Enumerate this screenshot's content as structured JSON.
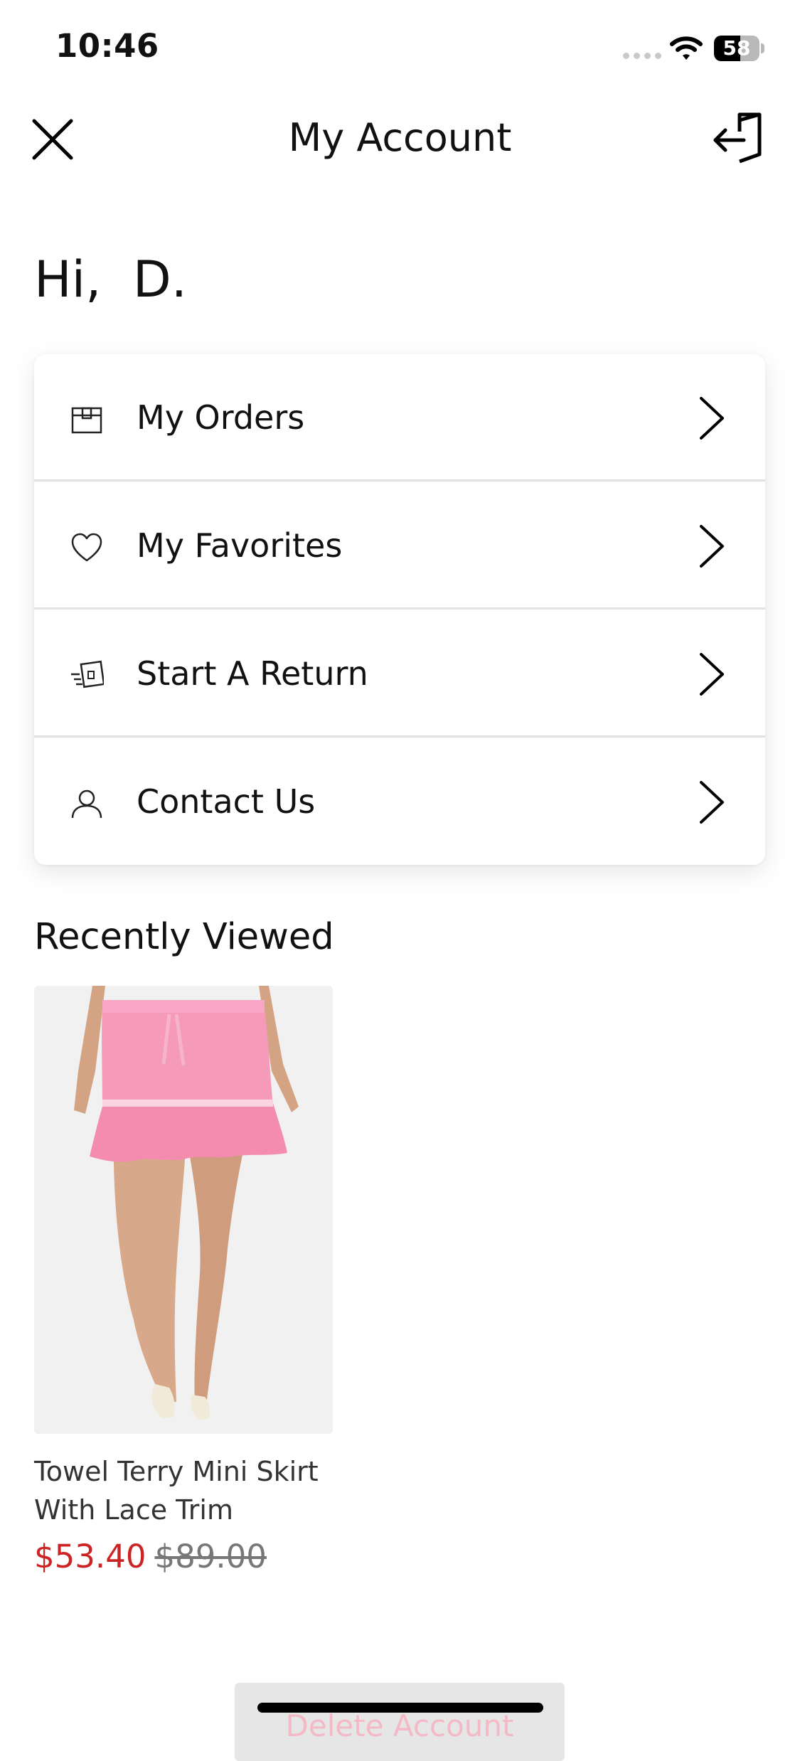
{
  "status_bar": {
    "time": "10:46",
    "battery": "58",
    "battery_level": 0.58
  },
  "header": {
    "title": "My Account"
  },
  "greeting": "Hi,  D.",
  "menu": {
    "items": [
      {
        "label": "My Orders",
        "icon": "package-icon"
      },
      {
        "label": "My Favorites",
        "icon": "heart-icon"
      },
      {
        "label": "Start A Return",
        "icon": "return-box-icon"
      },
      {
        "label": "Contact Us",
        "icon": "user-icon"
      }
    ]
  },
  "recently_viewed": {
    "title": "Recently Viewed",
    "product": {
      "name": "Towel Terry Mini Skirt With Lace Trim",
      "sale_price": "$53.40",
      "original_price": "$89.00"
    }
  },
  "footer": {
    "delete_label": "Delete Account"
  },
  "colors": {
    "sale": "#cc2424",
    "skirt": "#f59ab8",
    "background": "#ffffff"
  }
}
